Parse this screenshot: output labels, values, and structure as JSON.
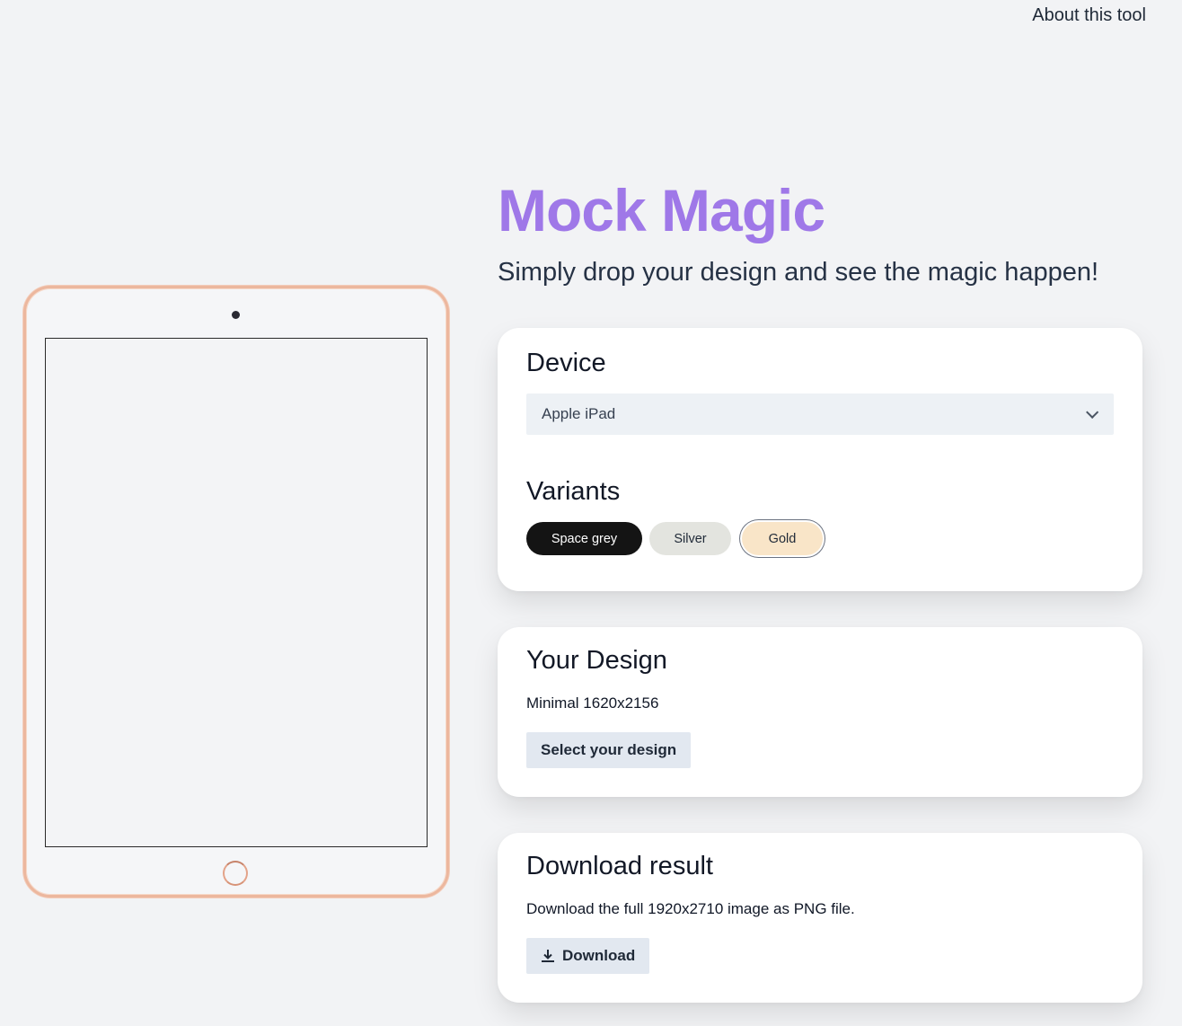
{
  "nav": {
    "about_label": "About this tool"
  },
  "hero": {
    "title": "Mock Magic",
    "subtitle": "Simply drop your design and see the magic happen!",
    "title_color": "#9f78e8"
  },
  "device_card": {
    "heading": "Device",
    "select": {
      "selected": "Apple iPad"
    },
    "variants_heading": "Variants",
    "variants": [
      {
        "label": "Space grey",
        "color": "#141414",
        "selected": false
      },
      {
        "label": "Silver",
        "color": "#e3e4df",
        "selected": false
      },
      {
        "label": "Gold",
        "color": "#f9e5c8",
        "selected": true
      }
    ]
  },
  "design_card": {
    "heading": "Your Design",
    "hint": "Minimal 1620x2156",
    "button_label": "Select your design"
  },
  "download_card": {
    "heading": "Download result",
    "description": "Download the full 1920x2710 image as PNG file.",
    "button_label": "Download",
    "button_icon": "download-icon"
  },
  "preview": {
    "device_frame_color": "#ecb79e"
  }
}
